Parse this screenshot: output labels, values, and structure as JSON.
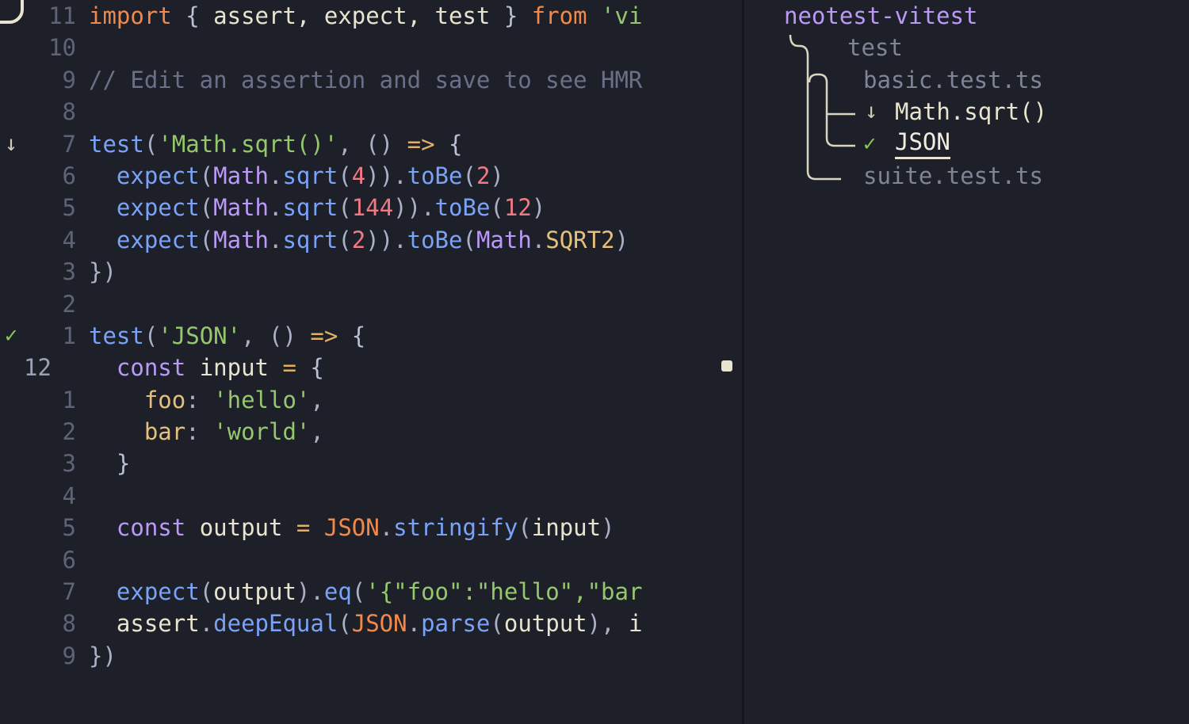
{
  "theme": {
    "background": "#1e2029",
    "split_line": "#15161d",
    "foreground": "#e8e4d0",
    "line_number": "#5f6377",
    "cursor_line_number": "#9ba0b4",
    "comment": "#6b7089",
    "string": "#96c76f",
    "keyword": "#f2894b",
    "function": "#7aa2f7",
    "number": "#ef7a85",
    "type": "#bb9af7",
    "constant": "#e5c07b",
    "operator": "#e0af68",
    "passed": "#8fc65a",
    "pending": "#cfcbb4",
    "window_border": "#e8e4d0"
  },
  "editor": {
    "cursor_absolute_line": "12",
    "cursor_column_marker": "•",
    "lines": [
      {
        "sign": "",
        "sign_kind": "",
        "relnum": "11",
        "is_cursor": false,
        "tokens": [
          {
            "text": "import",
            "cls": "t-keyword"
          },
          {
            "text": " ",
            "cls": "t-ident"
          },
          {
            "text": "{",
            "cls": "t-brace"
          },
          {
            "text": " assert, expect, test ",
            "cls": "t-ident"
          },
          {
            "text": "}",
            "cls": "t-brace"
          },
          {
            "text": " ",
            "cls": "t-ident"
          },
          {
            "text": "from",
            "cls": "t-keyword"
          },
          {
            "text": " ",
            "cls": "t-ident"
          },
          {
            "text": "'vi",
            "cls": "t-string"
          }
        ]
      },
      {
        "sign": "",
        "sign_kind": "",
        "relnum": "10",
        "is_cursor": false,
        "tokens": []
      },
      {
        "sign": "",
        "sign_kind": "",
        "relnum": "9",
        "is_cursor": false,
        "tokens": [
          {
            "text": "// Edit an assertion and save to see HMR",
            "cls": "t-comment"
          }
        ]
      },
      {
        "sign": "",
        "sign_kind": "",
        "relnum": "8",
        "is_cursor": false,
        "tokens": []
      },
      {
        "sign": "↓",
        "sign_kind": "sign-pending",
        "relnum": "7",
        "is_cursor": false,
        "tokens": [
          {
            "text": "test",
            "cls": "t-func"
          },
          {
            "text": "(",
            "cls": "t-punct"
          },
          {
            "text": "'Math.sqrt()'",
            "cls": "t-string"
          },
          {
            "text": ", ",
            "cls": "t-punct"
          },
          {
            "text": "()",
            "cls": "t-punct"
          },
          {
            "text": " ",
            "cls": "t-ident"
          },
          {
            "text": "=>",
            "cls": "t-arrow"
          },
          {
            "text": " ",
            "cls": "t-ident"
          },
          {
            "text": "{",
            "cls": "t-brace"
          }
        ]
      },
      {
        "sign": "",
        "sign_kind": "",
        "relnum": "6",
        "is_cursor": false,
        "tokens": [
          {
            "text": "  ",
            "cls": "t-ident"
          },
          {
            "text": "expect",
            "cls": "t-func"
          },
          {
            "text": "(",
            "cls": "t-punct"
          },
          {
            "text": "Math",
            "cls": "t-type"
          },
          {
            "text": ".",
            "cls": "t-punct"
          },
          {
            "text": "sqrt",
            "cls": "t-method"
          },
          {
            "text": "(",
            "cls": "t-punct"
          },
          {
            "text": "4",
            "cls": "t-number"
          },
          {
            "text": "))",
            "cls": "t-punct"
          },
          {
            "text": ".",
            "cls": "t-punct"
          },
          {
            "text": "toBe",
            "cls": "t-method"
          },
          {
            "text": "(",
            "cls": "t-punct"
          },
          {
            "text": "2",
            "cls": "t-number"
          },
          {
            "text": ")",
            "cls": "t-punct"
          }
        ]
      },
      {
        "sign": "",
        "sign_kind": "",
        "relnum": "5",
        "is_cursor": false,
        "tokens": [
          {
            "text": "  ",
            "cls": "t-ident"
          },
          {
            "text": "expect",
            "cls": "t-func"
          },
          {
            "text": "(",
            "cls": "t-punct"
          },
          {
            "text": "Math",
            "cls": "t-type"
          },
          {
            "text": ".",
            "cls": "t-punct"
          },
          {
            "text": "sqrt",
            "cls": "t-method"
          },
          {
            "text": "(",
            "cls": "t-punct"
          },
          {
            "text": "144",
            "cls": "t-number"
          },
          {
            "text": "))",
            "cls": "t-punct"
          },
          {
            "text": ".",
            "cls": "t-punct"
          },
          {
            "text": "toBe",
            "cls": "t-method"
          },
          {
            "text": "(",
            "cls": "t-punct"
          },
          {
            "text": "12",
            "cls": "t-number"
          },
          {
            "text": ")",
            "cls": "t-punct"
          }
        ]
      },
      {
        "sign": "",
        "sign_kind": "",
        "relnum": "4",
        "is_cursor": false,
        "tokens": [
          {
            "text": "  ",
            "cls": "t-ident"
          },
          {
            "text": "expect",
            "cls": "t-func"
          },
          {
            "text": "(",
            "cls": "t-punct"
          },
          {
            "text": "Math",
            "cls": "t-type"
          },
          {
            "text": ".",
            "cls": "t-punct"
          },
          {
            "text": "sqrt",
            "cls": "t-method"
          },
          {
            "text": "(",
            "cls": "t-punct"
          },
          {
            "text": "2",
            "cls": "t-number"
          },
          {
            "text": "))",
            "cls": "t-punct"
          },
          {
            "text": ".",
            "cls": "t-punct"
          },
          {
            "text": "toBe",
            "cls": "t-method"
          },
          {
            "text": "(",
            "cls": "t-punct"
          },
          {
            "text": "Math",
            "cls": "t-type"
          },
          {
            "text": ".",
            "cls": "t-punct"
          },
          {
            "text": "SQRT2",
            "cls": "t-const"
          },
          {
            "text": ")",
            "cls": "t-punct"
          }
        ]
      },
      {
        "sign": "",
        "sign_kind": "",
        "relnum": "3",
        "is_cursor": false,
        "tokens": [
          {
            "text": "})",
            "cls": "t-punct"
          }
        ]
      },
      {
        "sign": "",
        "sign_kind": "",
        "relnum": "2",
        "is_cursor": false,
        "tokens": []
      },
      {
        "sign": "✓",
        "sign_kind": "sign-passed",
        "relnum": "1",
        "is_cursor": false,
        "tokens": [
          {
            "text": "test",
            "cls": "t-func"
          },
          {
            "text": "(",
            "cls": "t-punct"
          },
          {
            "text": "'JSON'",
            "cls": "t-string"
          },
          {
            "text": ", ",
            "cls": "t-punct"
          },
          {
            "text": "()",
            "cls": "t-punct"
          },
          {
            "text": " ",
            "cls": "t-ident"
          },
          {
            "text": "=>",
            "cls": "t-arrow"
          },
          {
            "text": " ",
            "cls": "t-ident"
          },
          {
            "text": "{",
            "cls": "t-brace"
          }
        ]
      },
      {
        "sign": "",
        "sign_kind": "",
        "relnum": "12",
        "is_cursor": true,
        "tokens": [
          {
            "text": "  ",
            "cls": "t-ident"
          },
          {
            "text": "const",
            "cls": "t-declare"
          },
          {
            "text": " input ",
            "cls": "t-ident"
          },
          {
            "text": "=",
            "cls": "t-op"
          },
          {
            "text": " ",
            "cls": "t-ident"
          },
          {
            "text": "{",
            "cls": "t-brace"
          }
        ]
      },
      {
        "sign": "",
        "sign_kind": "",
        "relnum": "1",
        "is_cursor": false,
        "tokens": [
          {
            "text": "    ",
            "cls": "t-ident"
          },
          {
            "text": "foo",
            "cls": "t-prop"
          },
          {
            "text": ": ",
            "cls": "t-punct"
          },
          {
            "text": "'hello'",
            "cls": "t-string"
          },
          {
            "text": ",",
            "cls": "t-punct"
          }
        ]
      },
      {
        "sign": "",
        "sign_kind": "",
        "relnum": "2",
        "is_cursor": false,
        "tokens": [
          {
            "text": "    ",
            "cls": "t-ident"
          },
          {
            "text": "bar",
            "cls": "t-prop"
          },
          {
            "text": ": ",
            "cls": "t-punct"
          },
          {
            "text": "'world'",
            "cls": "t-string"
          },
          {
            "text": ",",
            "cls": "t-punct"
          }
        ]
      },
      {
        "sign": "",
        "sign_kind": "",
        "relnum": "3",
        "is_cursor": false,
        "tokens": [
          {
            "text": "  }",
            "cls": "t-brace"
          }
        ]
      },
      {
        "sign": "",
        "sign_kind": "",
        "relnum": "4",
        "is_cursor": false,
        "tokens": []
      },
      {
        "sign": "",
        "sign_kind": "",
        "relnum": "5",
        "is_cursor": false,
        "tokens": [
          {
            "text": "  ",
            "cls": "t-ident"
          },
          {
            "text": "const",
            "cls": "t-declare"
          },
          {
            "text": " output ",
            "cls": "t-ident"
          },
          {
            "text": "=",
            "cls": "t-op"
          },
          {
            "text": " ",
            "cls": "t-ident"
          },
          {
            "text": "JSON",
            "cls": "t-builtin"
          },
          {
            "text": ".",
            "cls": "t-punct"
          },
          {
            "text": "stringify",
            "cls": "t-method"
          },
          {
            "text": "(",
            "cls": "t-punct"
          },
          {
            "text": "input",
            "cls": "t-ident"
          },
          {
            "text": ")",
            "cls": "t-punct"
          }
        ]
      },
      {
        "sign": "",
        "sign_kind": "",
        "relnum": "6",
        "is_cursor": false,
        "tokens": []
      },
      {
        "sign": "",
        "sign_kind": "",
        "relnum": "7",
        "is_cursor": false,
        "tokens": [
          {
            "text": "  ",
            "cls": "t-ident"
          },
          {
            "text": "expect",
            "cls": "t-func"
          },
          {
            "text": "(",
            "cls": "t-punct"
          },
          {
            "text": "output",
            "cls": "t-ident"
          },
          {
            "text": ")",
            "cls": "t-punct"
          },
          {
            "text": ".",
            "cls": "t-punct"
          },
          {
            "text": "eq",
            "cls": "t-method"
          },
          {
            "text": "(",
            "cls": "t-punct"
          },
          {
            "text": "'{\"foo\":\"hello\",\"bar",
            "cls": "t-string"
          }
        ]
      },
      {
        "sign": "",
        "sign_kind": "",
        "relnum": "8",
        "is_cursor": false,
        "tokens": [
          {
            "text": "  ",
            "cls": "t-ident"
          },
          {
            "text": "assert",
            "cls": "t-ident"
          },
          {
            "text": ".",
            "cls": "t-punct"
          },
          {
            "text": "deepEqual",
            "cls": "t-method"
          },
          {
            "text": "(",
            "cls": "t-punct"
          },
          {
            "text": "JSON",
            "cls": "t-builtin"
          },
          {
            "text": ".",
            "cls": "t-punct"
          },
          {
            "text": "parse",
            "cls": "t-method"
          },
          {
            "text": "(",
            "cls": "t-punct"
          },
          {
            "text": "output",
            "cls": "t-ident"
          },
          {
            "text": "), ",
            "cls": "t-punct"
          },
          {
            "text": "i",
            "cls": "t-ident"
          }
        ]
      },
      {
        "sign": "",
        "sign_kind": "",
        "relnum": "9",
        "is_cursor": false,
        "tokens": [
          {
            "text": "})",
            "cls": "t-punct"
          }
        ]
      }
    ]
  },
  "summary": {
    "title": "neotest-vitest",
    "rows": [
      {
        "label": "test",
        "kind": "dir",
        "icon": "",
        "icon_kind": "",
        "selected": false
      },
      {
        "label": "basic.test.ts",
        "kind": "file",
        "icon": "",
        "icon_kind": "",
        "selected": false
      },
      {
        "label": "Math.sqrt()",
        "kind": "test",
        "icon": "↓",
        "icon_kind": "icon-pending",
        "selected": false
      },
      {
        "label": "JSON",
        "kind": "test",
        "icon": "✓",
        "icon_kind": "icon-passed",
        "selected": true
      },
      {
        "label": "suite.test.ts",
        "kind": "file",
        "icon": "",
        "icon_kind": "",
        "selected": false
      }
    ]
  }
}
